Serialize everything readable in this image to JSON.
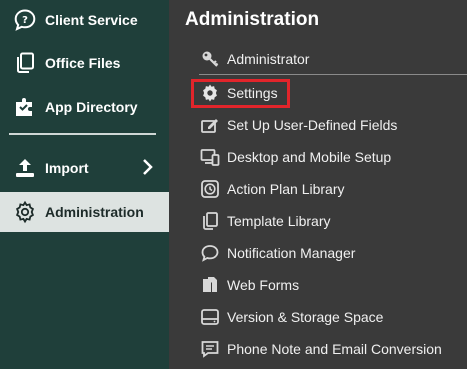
{
  "sidebar": {
    "items": [
      {
        "label": "Client Service",
        "icon": "speech-bubble-question-icon"
      },
      {
        "label": "Office Files",
        "icon": "documents-icon"
      },
      {
        "label": "App Directory",
        "icon": "puzzle-icon"
      },
      {
        "label": "Import",
        "icon": "upload-tray-icon"
      },
      {
        "label": "Administration",
        "icon": "gear-icon"
      }
    ],
    "active_item": "Administration"
  },
  "panel": {
    "title": "Administration",
    "items": [
      {
        "label": "Administrator",
        "icon": "key-icon"
      },
      {
        "label": "Settings",
        "icon": "gear-icon"
      },
      {
        "label": "Set Up User-Defined Fields",
        "icon": "edit-form-icon"
      },
      {
        "label": "Desktop and Mobile Setup",
        "icon": "desktop-mobile-icon"
      },
      {
        "label": "Action Plan Library",
        "icon": "clock-icon"
      },
      {
        "label": "Template Library",
        "icon": "documents-icon"
      },
      {
        "label": "Notification Manager",
        "icon": "chat-bubble-icon"
      },
      {
        "label": "Web Forms",
        "icon": "files-icon"
      },
      {
        "label": "Version & Storage Space",
        "icon": "storage-icon"
      },
      {
        "label": "Phone Note and Email Conversion",
        "icon": "message-icon"
      }
    ]
  },
  "colors": {
    "sidebar_bg": "#1f3f3a",
    "panel_bg": "#3a3a3a",
    "active_bg": "#dde3e1",
    "highlight_border": "#e2252b"
  }
}
